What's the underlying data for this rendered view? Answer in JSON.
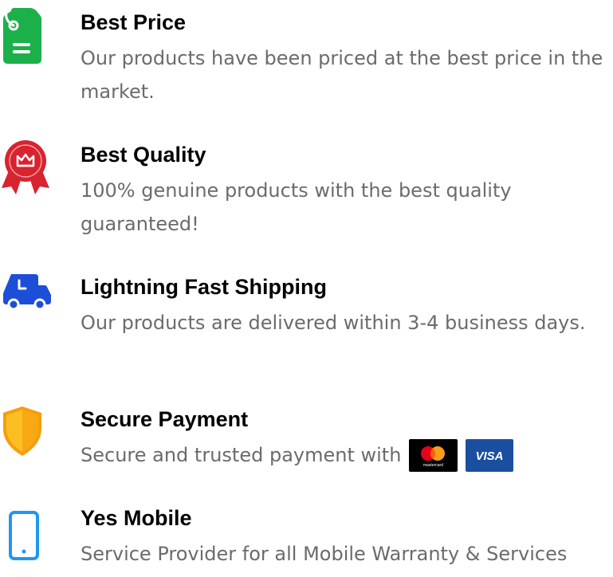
{
  "features": [
    {
      "title": "Best Price",
      "description": "Our products have been priced at the best price in the market.",
      "icon": "price-tag-icon",
      "icon_color": "#1bb04a"
    },
    {
      "title": "Best Quality",
      "description": "100% genuine products with the best quality guaranteed!",
      "icon": "quality-badge-icon",
      "icon_color": "#d9232e"
    },
    {
      "title": "Lightning Fast Shipping",
      "description": "Our products are delivered within 3-4 business days.",
      "icon": "delivery-truck-icon",
      "icon_color": "#1d4ed8"
    },
    {
      "title": "Secure Payment",
      "description": "Secure and trusted payment with",
      "icon": "shield-icon",
      "icon_color": "#f59e0b",
      "payment_methods": [
        {
          "name": "mastercard",
          "label": "mastercard",
          "background": "#000000"
        },
        {
          "name": "visa",
          "label": "VISA",
          "background": "#1a4fa0"
        }
      ]
    },
    {
      "title": "Yes Mobile",
      "description": "Service Provider for all Mobile Warranty & Services",
      "icon": "mobile-phone-icon",
      "icon_color": "#2196f3"
    }
  ]
}
